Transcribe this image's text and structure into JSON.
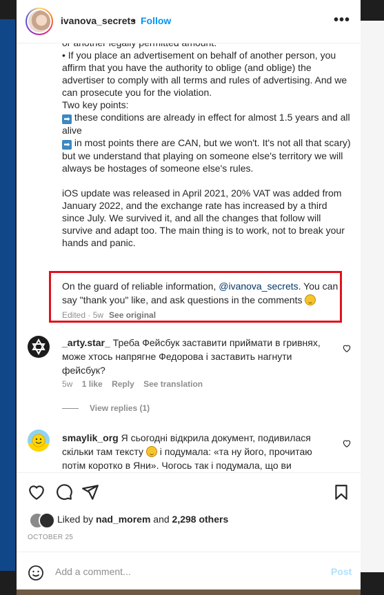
{
  "header": {
    "username": "ivanova_secrets",
    "separator": "•",
    "follow_label": "Follow",
    "more_label": "•••"
  },
  "caption": {
    "lines": [
      "or another legally permitted amount.",
      "• If you place an advertisement on behalf of another person, you affirm that you have the authority to oblige (and oblige) the advertiser to comply with all terms and rules of advertising. And we can prosecute you for the violation.",
      "",
      "Two key points:"
    ],
    "point1_arrow": "➡",
    "point1": " these conditions are already in effect for almost 1.5 years and all alive",
    "point2_arrow": "➡",
    "point2": " in most points there are CAN, but we won't. It's not all that scary) but we understand that playing on someone else's territory we will always be hostages of someone else's rules.",
    "paragraph": "iOS update was released in April 2021, 20% VAT was added from January 2022, and the exchange rate has increased by a third since July. We survived it, and all the changes that follow will survive and adapt too. The main thing is to work, not to break your hands and panic.",
    "guard_before": "On the guard of reliable information, ",
    "guard_mention": "@ivanova_secrets",
    "guard_after": ". You can say \"thank you\" like, and ask questions in the comments ",
    "edited": "Edited · 5w",
    "see_original": "See original"
  },
  "comments": [
    {
      "username": "_arty.star_",
      "text": " Треба Фейсбук заставити приймати в гривнях, може хтось напрягне Федорова і заставить нагнути фейсбук?",
      "time": "5w",
      "likes": "1 like",
      "reply": "Reply",
      "translation": "See translation",
      "view_replies": "View replies (1)"
    },
    {
      "username": "smaylik_org",
      "text_before": " Я сьогодні відкрила документ, подивилася скільки там тексту ",
      "text_after": " і подумала: «та ну його, прочитаю потім коротко в Яни». Чогось так і подумала, що ви"
    }
  ],
  "footer": {
    "liked_by": "Liked by ",
    "liked_user": "nad_morem",
    "and": " and ",
    "others": "2,298 others",
    "date": "OCTOBER 25",
    "comment_placeholder": "Add a comment...",
    "post_label": "Post"
  },
  "colors": {
    "accent": "#0095f6",
    "highlight_border": "#e0121b",
    "mention": "#00376b"
  }
}
